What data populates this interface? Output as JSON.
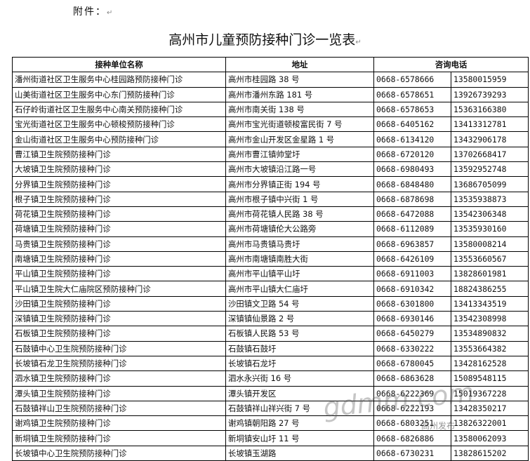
{
  "attachment_label": "附件：",
  "title": "高州市儿童预防接种门诊一览表",
  "headers": {
    "unit": "接种单位名称",
    "address": "地址",
    "phone": "咨询电话"
  },
  "rows": [
    [
      "潘州街道社区卫生服务中心桂园路预防接种门诊",
      "高州市桂园路 38 号",
      "0668-6578666",
      "13580015959"
    ],
    [
      "山美街道社区卫生服务中心东门预防接种门诊",
      "高州市潘州东路 181 号",
      "0668-6578651",
      "13926739293"
    ],
    [
      "石仔岭街道社区卫生服务中心南关预防接种门诊",
      "高州市南关街 138 号",
      "0668-6578653",
      "15363166380"
    ],
    [
      "宝光街道社区卫生服务中心顿梭预防接种门诊",
      "高州市宝光街道顿梭富民街 7 号",
      "0668-6405162",
      "13413312781"
    ],
    [
      "金山街道社区卫生服务中心预防接种门诊",
      "高州市金山开发区金星路 1 号",
      "0668-6134120",
      "13432906178"
    ],
    [
      "曹江镇卫生院预防接种门诊",
      "高州市曹江镇帅堂圩",
      "0668-6720120",
      "13702668417"
    ],
    [
      "大坡镇卫生院预防接种门诊",
      "高州市大坡镇沿江路一号",
      "0668-6980493",
      "13592952748"
    ],
    [
      "分界镇卫生院预防接种门诊",
      "高州市分界镇正街 194 号",
      "0668-6848480",
      "13686705099"
    ],
    [
      "根子镇卫生院预防接种门诊",
      "高州市根子镇中兴街 1 号",
      "0668-6878698",
      "13535938873"
    ],
    [
      "荷花镇卫生院预防接种门诊",
      "高州市荷花镇人民路 38 号",
      "0668-6472088",
      "13542306348"
    ],
    [
      "荷塘镇卫生院预防接种门诊",
      "高州市荷塘镇伦大公路旁",
      "0668-6112089",
      "13535930160"
    ],
    [
      "马贵镇卫生院预防接种门诊",
      "高州市马贵镇马贵圩",
      "0668-6963857",
      "13580008214"
    ],
    [
      "南塘镇卫生院预防接种门诊",
      "高州市南塘镇南胜大街",
      "0668-6426109",
      "13553660567"
    ],
    [
      "平山镇卫生院预防接种门诊",
      "高州市平山镇平山圩",
      "0668-6911003",
      "13828601981"
    ],
    [
      "平山镇卫生院大仁庙院区预防接种门诊",
      "高州市平山镇大仁庙圩",
      "0668-6910342",
      "18824386255"
    ],
    [
      "沙田镇卫生院预防接种门诊",
      "沙田镇文卫路 54 号",
      "0668-6301800",
      "13413343519"
    ],
    [
      "深镇镇卫生院预防接种门诊",
      "深镇镇仙景路 2 号",
      "0668-6930146",
      "13542308998"
    ],
    [
      "石板镇卫生院预防接种门诊",
      "石板镇人民路 53 号",
      "0668-6450279",
      "13534890832"
    ],
    [
      "石鼓镇中心卫生院预防接种门诊",
      "石鼓镇石鼓圩",
      "0668-6330222",
      "13553664382"
    ],
    [
      "长坡镇石龙卫生院预防接种门诊",
      "长坡镇石龙圩",
      "0668-6780045",
      "13428162528"
    ],
    [
      "泗水镇卫生院预防接种门诊",
      "泗水永兴街 16 号",
      "0668-6863628",
      "15089548115"
    ],
    [
      "潭头镇卫生院预防接种门诊",
      "潭头镇开发区",
      "0668-6222369",
      "15019367228"
    ],
    [
      "石鼓镇祥山卫生院预防接种门诊",
      "石鼓镇祥山祥兴街 7 号",
      "0668-6222193",
      "13428350217"
    ],
    [
      "谢鸡镇卫生院预防接种门诊",
      "谢鸡镇朝阳路 27 号",
      "0668-6803251",
      "13826322001"
    ],
    [
      "新垌镇卫生院预防接种门诊",
      "新垌镇安山圩 11 号",
      "0668-6826886",
      "13580062093"
    ],
    [
      "长坡镇中心卫生院预防接种门诊",
      "长坡镇玉湖路",
      "0668-6730231",
      "13828615202"
    ]
  ],
  "watermark": "gdmm.com",
  "watermark_sub": "高州发布"
}
